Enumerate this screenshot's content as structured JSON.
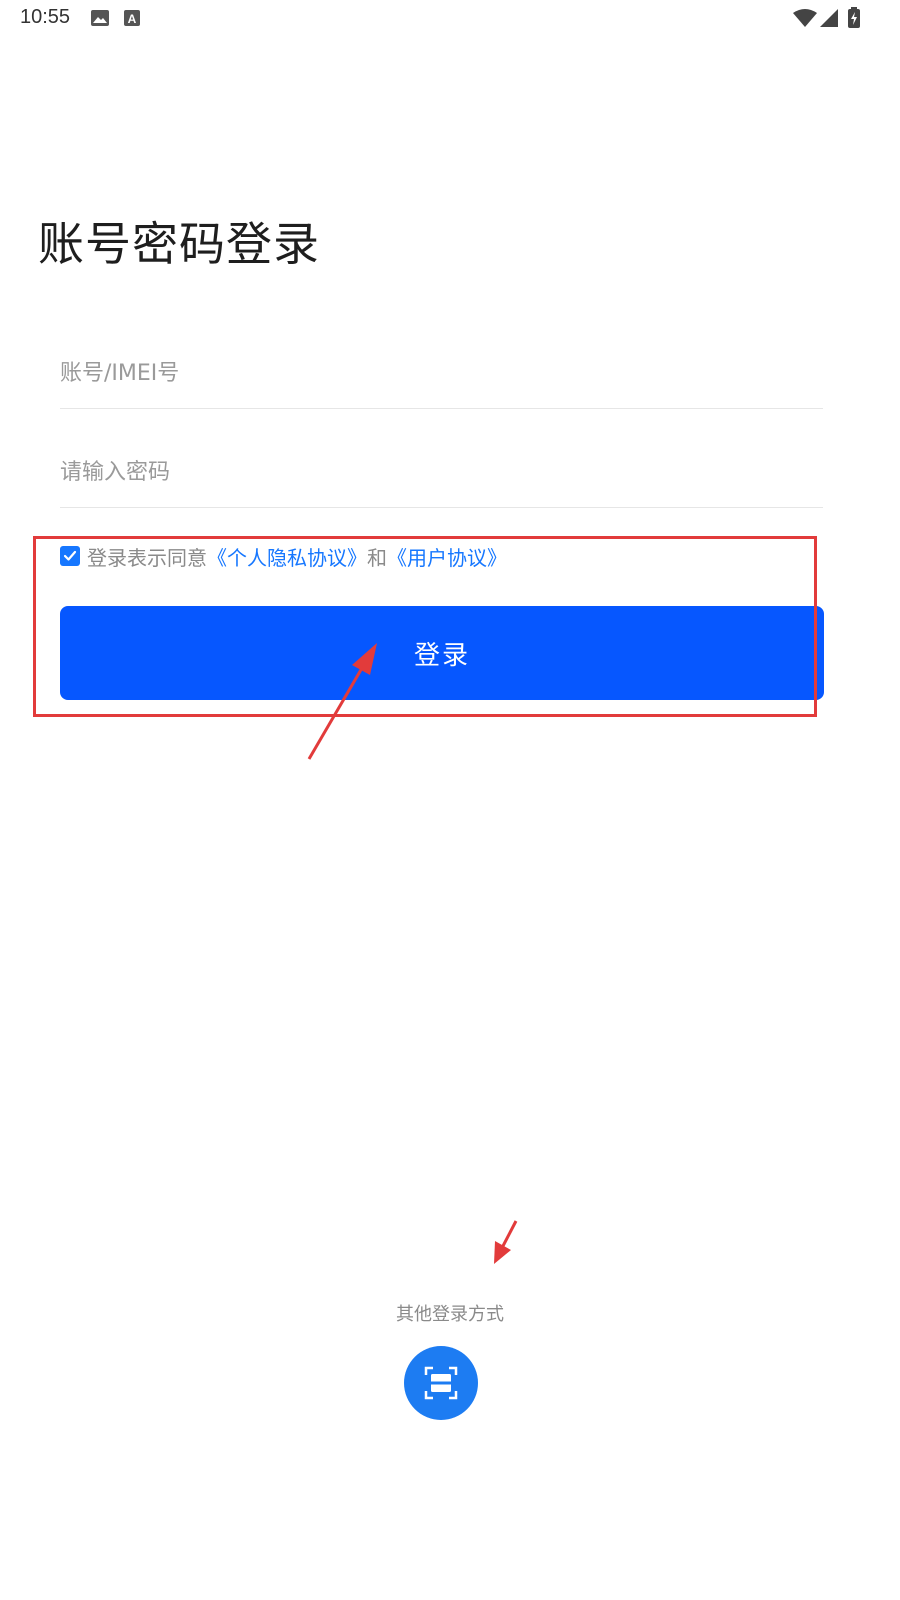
{
  "status_bar": {
    "time": "10:55",
    "left_icons": [
      "image-icon",
      "text-a-icon"
    ],
    "right_icons": [
      "wifi-icon",
      "cell-signal-icon",
      "battery-charging-icon"
    ]
  },
  "title": "账号密码登录",
  "username": {
    "placeholder": "账号/IMEI号",
    "value": ""
  },
  "password": {
    "placeholder": "请输入密码",
    "value": ""
  },
  "agreement": {
    "checked": true,
    "prefix": "登录表示同意",
    "privacy_link": "《个人隐私协议》",
    "conjunction": "和",
    "user_link": "《用户协议》"
  },
  "login_button": "登录",
  "other_login": {
    "label": "其他登录方式",
    "scan_icon": "scan-icon"
  },
  "colors": {
    "accent": "#0657ff",
    "link": "#1677ff",
    "annotation": "#e23b3b",
    "scan_button": "#1d7cf2"
  }
}
